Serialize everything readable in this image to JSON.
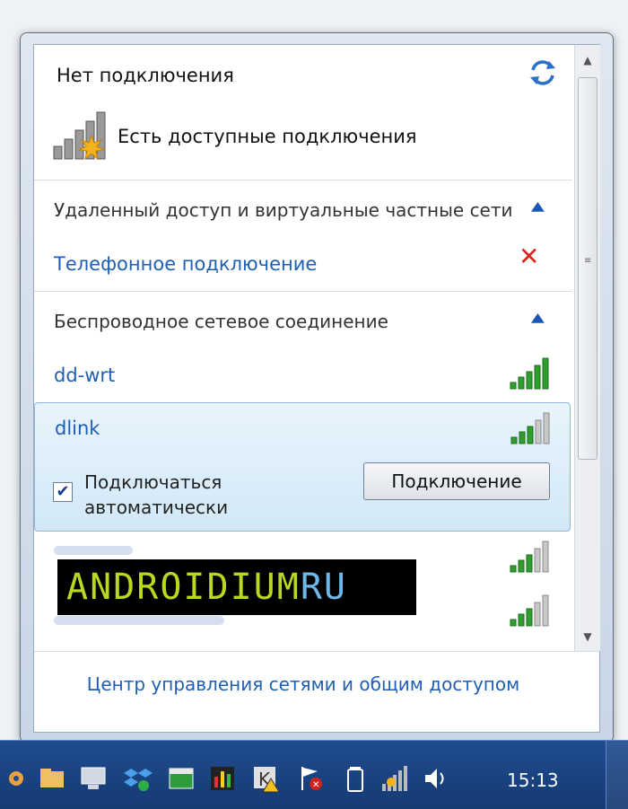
{
  "status": {
    "title": "Нет подключения",
    "subtitle": "Есть доступные подключения"
  },
  "sections": {
    "remote": {
      "title": "Удаленный доступ и виртуальные частные сети",
      "items": [
        {
          "label": "Телефонное подключение"
        }
      ]
    },
    "wireless": {
      "title": "Беспроводное сетевое соединение",
      "networks": [
        {
          "ssid": "dd-wrt",
          "signal": 5
        },
        {
          "ssid": "dlink",
          "signal": 3
        },
        {
          "ssid": "",
          "signal": 3
        },
        {
          "ssid": "",
          "signal": 3
        }
      ]
    }
  },
  "selected_network": {
    "auto_connect_label": "Подключаться автоматически",
    "auto_connect_checked": true,
    "connect_button": "Подключение"
  },
  "watermark": {
    "part1": "ANDROIDIUM",
    "part2": "RU"
  },
  "footer": {
    "link": "Центр управления сетями и общим доступом"
  },
  "taskbar": {
    "clock": "15:13",
    "tray_icons": [
      "settings-icon",
      "folder-icon",
      "computer-icon",
      "dropbox-icon",
      "green-app-icon",
      "chart-icon",
      "kaspersky-icon",
      "action-center-flag-icon",
      "battery-icon",
      "network-signal-icon",
      "volume-icon"
    ]
  },
  "colors": {
    "link": "#1e5fb4",
    "accent_blue": "#1a56b5",
    "error": "#d6281e",
    "signal_green": "#2f9e2f"
  }
}
